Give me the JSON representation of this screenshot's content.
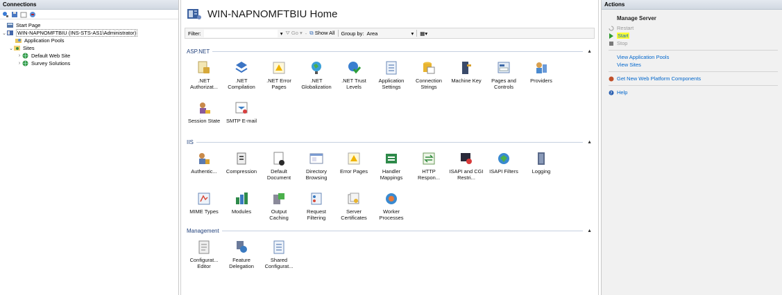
{
  "connections": {
    "title": "Connections",
    "tree": [
      {
        "label": "Start Page",
        "icon": "start-page-icon"
      },
      {
        "label": "WIN-NAPNOMFTBIU (INS-STS-AS1\\Administrator)",
        "icon": "server-icon"
      },
      {
        "label": "Application Pools",
        "icon": "app-pools-icon"
      },
      {
        "label": "Sites",
        "icon": "sites-icon"
      },
      {
        "label": "Default Web Site",
        "icon": "globe-icon"
      },
      {
        "label": "Survey Solutions",
        "icon": "globe-icon"
      }
    ]
  },
  "main": {
    "title": "WIN-NAPNOMFTBIU Home",
    "filter": {
      "label": "Filter:",
      "value": "",
      "go": "Go",
      "show_all": "Show All",
      "group_by": "Group by:",
      "group_by_value": "Area"
    },
    "groups": [
      {
        "name": "ASP.NET",
        "features": [
          {
            "label": ".NET Authorizat...",
            "icon": "net-authorization-icon"
          },
          {
            "label": ".NET Compilation",
            "icon": "net-compilation-icon"
          },
          {
            "label": ".NET Error Pages",
            "icon": "net-error-pages-icon"
          },
          {
            "label": ".NET Globalization",
            "icon": "net-globalization-icon"
          },
          {
            "label": ".NET Trust Levels",
            "icon": "net-trust-levels-icon"
          },
          {
            "label": "Application Settings",
            "icon": "application-settings-icon"
          },
          {
            "label": "Connection Strings",
            "icon": "connection-strings-icon"
          },
          {
            "label": "Machine Key",
            "icon": "machine-key-icon"
          },
          {
            "label": "Pages and Controls",
            "icon": "pages-controls-icon"
          },
          {
            "label": "Providers",
            "icon": "providers-icon"
          },
          {
            "label": "Session State",
            "icon": "session-state-icon"
          },
          {
            "label": "SMTP E-mail",
            "icon": "smtp-email-icon"
          }
        ]
      },
      {
        "name": "IIS",
        "features": [
          {
            "label": "Authentic...",
            "icon": "authentication-icon"
          },
          {
            "label": "Compression",
            "icon": "compression-icon"
          },
          {
            "label": "Default Document",
            "icon": "default-document-icon"
          },
          {
            "label": "Directory Browsing",
            "icon": "directory-browsing-icon"
          },
          {
            "label": "Error Pages",
            "icon": "error-pages-icon"
          },
          {
            "label": "Handler Mappings",
            "icon": "handler-mappings-icon"
          },
          {
            "label": "HTTP Respon...",
            "icon": "http-response-icon"
          },
          {
            "label": "ISAPI and CGI Restri...",
            "icon": "isapi-cgi-icon"
          },
          {
            "label": "ISAPI Filters",
            "icon": "isapi-filters-icon"
          },
          {
            "label": "Logging",
            "icon": "logging-icon"
          },
          {
            "label": "MIME Types",
            "icon": "mime-types-icon"
          },
          {
            "label": "Modules",
            "icon": "modules-icon"
          },
          {
            "label": "Output Caching",
            "icon": "output-caching-icon"
          },
          {
            "label": "Request Filtering",
            "icon": "request-filtering-icon"
          },
          {
            "label": "Server Certificates",
            "icon": "server-certificates-icon"
          },
          {
            "label": "Worker Processes",
            "icon": "worker-processes-icon"
          }
        ]
      },
      {
        "name": "Management",
        "features": [
          {
            "label": "Configurat... Editor",
            "icon": "configuration-editor-icon"
          },
          {
            "label": "Feature Delegation",
            "icon": "feature-delegation-icon"
          },
          {
            "label": "Shared Configurat...",
            "icon": "shared-configuration-icon"
          }
        ]
      }
    ]
  },
  "actions": {
    "title": "Actions",
    "manage_server": "Manage Server",
    "restart": "Restart",
    "start": "Start",
    "stop": "Stop",
    "view_app_pools": "View Application Pools",
    "view_sites": "View Sites",
    "get_components": "Get New Web Platform Components",
    "help": "Help"
  },
  "colors": {
    "link": "#0066cc",
    "highlight": "#ffff33",
    "group_header": "#1f3f7a"
  }
}
